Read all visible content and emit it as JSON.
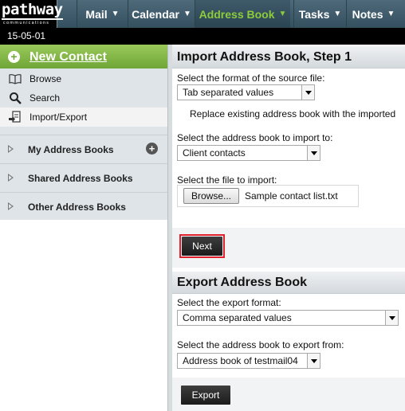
{
  "brand": {
    "name": "pathway",
    "tagline": "communications"
  },
  "nav": {
    "items": [
      {
        "label": "Mail"
      },
      {
        "label": "Calendar"
      },
      {
        "label": "Address Book"
      },
      {
        "label": "Tasks"
      },
      {
        "label": "Notes"
      }
    ],
    "active": "Address Book"
  },
  "datebar": {
    "text": "15-05-01"
  },
  "sidebar": {
    "new_contact": "New Contact",
    "items": [
      {
        "label": "Browse",
        "icon": "book-icon"
      },
      {
        "label": "Search",
        "icon": "search-icon"
      },
      {
        "label": "Import/Export",
        "icon": "import-export-icon",
        "selected": true
      }
    ],
    "groups": [
      {
        "label": "My Address Books"
      },
      {
        "label": "Shared Address Books"
      },
      {
        "label": "Other Address Books"
      }
    ]
  },
  "import": {
    "title": "Import Address Book, Step 1",
    "format_label": "Select the format of the source file:",
    "format_value": "Tab separated values",
    "replace_label": "Replace existing address book with the imported",
    "replace_checked": false,
    "target_label": "Select the address book to import to:",
    "target_value": "Client contacts",
    "file_label": "Select the file to import:",
    "browse_label": "Browse...",
    "file_name": "Sample contact list.txt",
    "next_label": "Next"
  },
  "export": {
    "title": "Export Address Book",
    "format_label": "Select the export format:",
    "format_value": "Comma separated values",
    "source_label": "Select the address book to export from:",
    "source_value": "Address book of testmail04",
    "export_label": "Export"
  },
  "colors": {
    "accent_green": "#8ccc3c",
    "highlight_red": "#e0202a",
    "topbar": "#415d6c"
  }
}
